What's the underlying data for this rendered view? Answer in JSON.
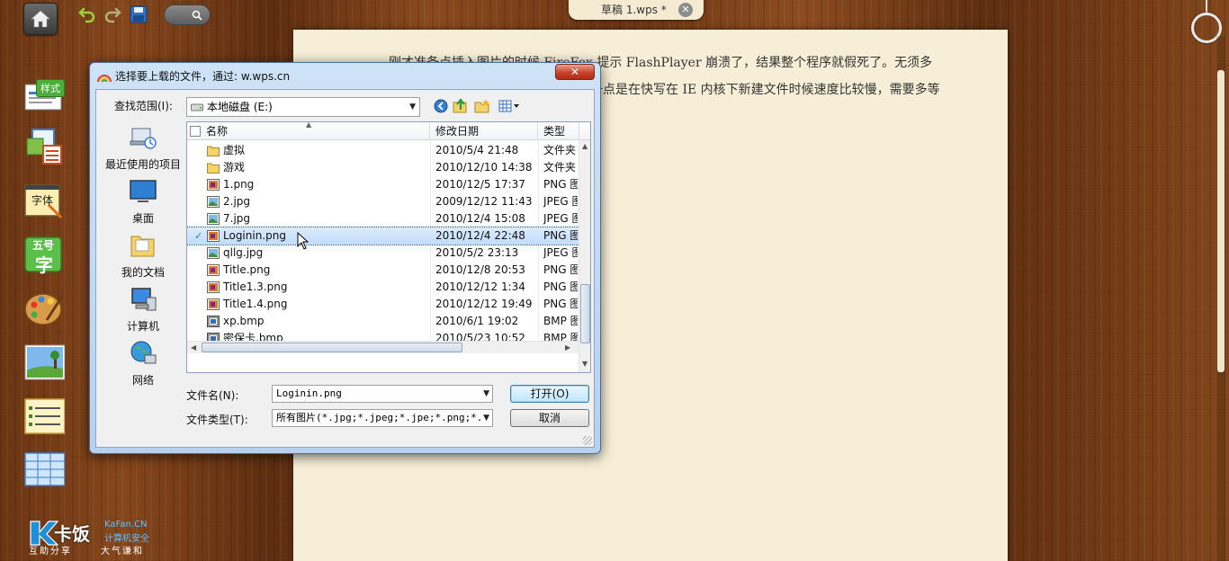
{
  "toolbar": {
    "doc_tab_title": "草稿 1.wps *",
    "close_glyph": "✕"
  },
  "page": {
    "text": "刚才准备点插入图片的时候 FireFox 提示 FlashPlayer 崩溃了，结果整个程序就假死了。无须多说，这算是在线应用的通病吧。另外一点是在快写在 IE 内核下新建文件时候速度比较慢，需要多等"
  },
  "dock": {
    "style_label": "样式",
    "font_label": "字体",
    "size_label": "五号",
    "size_char": "字"
  },
  "watermark": {
    "brand": "卡饭",
    "site": "KaFan.CN",
    "slogan1": "计算机安全",
    "slogan2": "互助分享",
    "slogan3": "大气谦和"
  },
  "dialog": {
    "title": "选择要上载的文件，通过: w.wps.cn",
    "close_label": "✕",
    "look_in_label": "查找范围(I):",
    "look_in_value": "本地磁盘 (E:)",
    "places": [
      {
        "label": "最近使用的项目",
        "icon": "recent-items-icon"
      },
      {
        "label": "桌面",
        "icon": "desktop-icon"
      },
      {
        "label": "我的文档",
        "icon": "my-documents-icon"
      },
      {
        "label": "计算机",
        "icon": "computer-icon"
      },
      {
        "label": "网络",
        "icon": "network-icon"
      }
    ],
    "columns": {
      "name": "名称",
      "date": "修改日期",
      "type": "类型"
    },
    "files": [
      {
        "name": "虚拟",
        "date": "2010/5/4 21:48",
        "type": "文件夹",
        "icon": "folder"
      },
      {
        "name": "游戏",
        "date": "2010/12/10 14:38",
        "type": "文件夹",
        "icon": "folder"
      },
      {
        "name": "1.png",
        "date": "2010/12/5 17:37",
        "type": "PNG 图",
        "icon": "png"
      },
      {
        "name": "2.jpg",
        "date": "2009/12/12 11:43",
        "type": "JPEG 图",
        "icon": "jpg"
      },
      {
        "name": "7.jpg",
        "date": "2010/12/4 15:08",
        "type": "JPEG 图",
        "icon": "jpg"
      },
      {
        "name": "Loginin.png",
        "date": "2010/12/4 22:48",
        "type": "PNG 图",
        "icon": "png",
        "selected": true
      },
      {
        "name": "qllg.jpg",
        "date": "2010/5/2 23:13",
        "type": "JPEG 图",
        "icon": "jpg"
      },
      {
        "name": "Title.png",
        "date": "2010/12/8 20:53",
        "type": "PNG 图",
        "icon": "png"
      },
      {
        "name": "Title1.3.png",
        "date": "2010/12/12 1:34",
        "type": "PNG 图",
        "icon": "png"
      },
      {
        "name": "Title1.4.png",
        "date": "2010/12/12 19:49",
        "type": "PNG 图",
        "icon": "png"
      },
      {
        "name": "xp.bmp",
        "date": "2010/6/1 19:02",
        "type": "BMP 图",
        "icon": "bmp"
      },
      {
        "name": "密保卡.bmp",
        "date": "2010/5/23 10:52",
        "type": "BMP 图",
        "icon": "bmp"
      }
    ],
    "filename_label": "文件名(N):",
    "filename_value": "Loginin.png",
    "filetype_label": "文件类型(T):",
    "filetype_value": "所有图片(*.jpg;*.jpeg;*.jpe;*.png;*.e",
    "open_label": "打开(O)",
    "cancel_label": "取消"
  },
  "colors": {
    "accent_green": "#4cae3b",
    "selection": "#c1dcfc",
    "dialog_frame": "#b7d1ee"
  }
}
